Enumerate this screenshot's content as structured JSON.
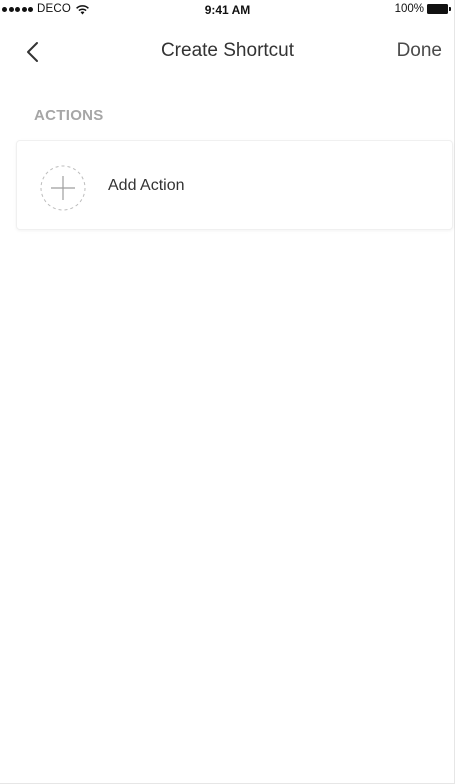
{
  "status_bar": {
    "carrier": "DECO",
    "time": "9:41 AM",
    "battery": "100%"
  },
  "nav": {
    "title": "Create Shortcut",
    "done_label": "Done"
  },
  "sections": {
    "actions": {
      "header": "ACTIONS",
      "add_label": "Add Action"
    }
  }
}
